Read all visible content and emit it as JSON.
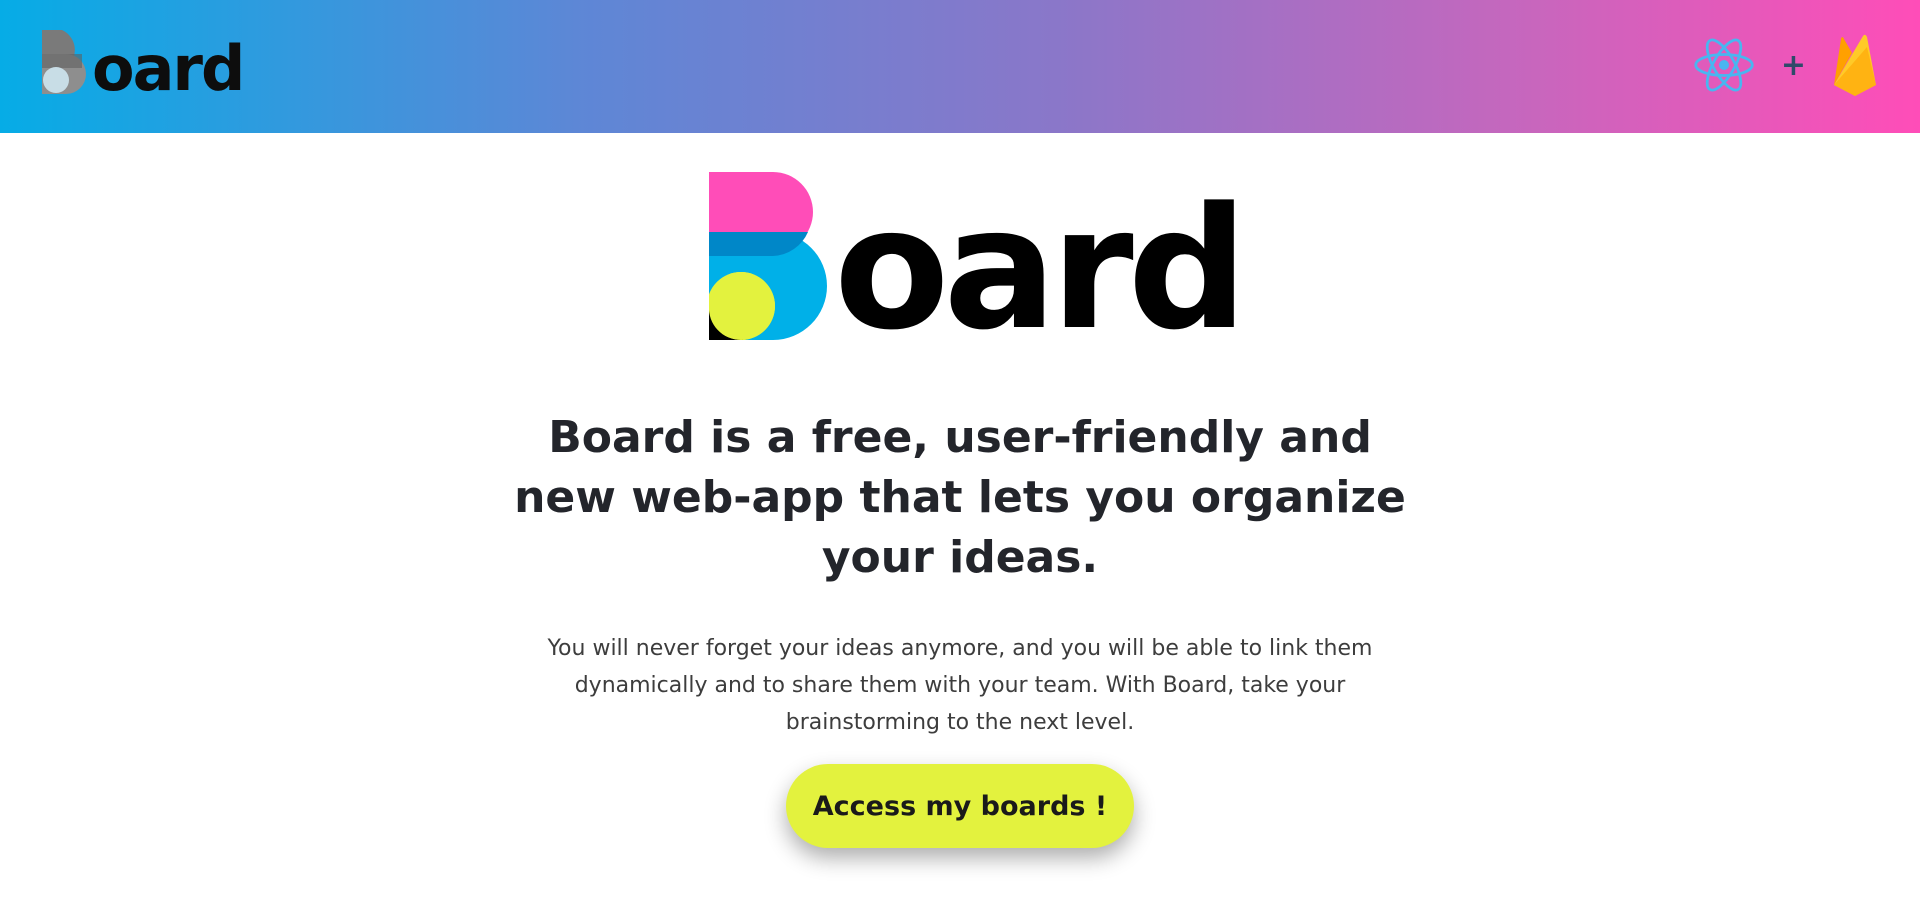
{
  "header": {
    "logo": {
      "icon": "board-b-logo-icon",
      "wordmark": "oard"
    },
    "tech_stack": {
      "items": [
        "react-icon",
        "firebase-icon"
      ],
      "separator": "+"
    }
  },
  "hero": {
    "logo": {
      "icon": "board-b-logo-icon",
      "wordmark": "oard"
    },
    "headline": "Board is a free, user-friendly and new web-app that lets you organize your ideas.",
    "description": "You will never forget your ideas anymore, and you will be able to link them dynamically and to share them with your team. With Board, take your brainstorming to the next level.",
    "cta_label": "Access my boards !"
  },
  "colors": {
    "brand_pink": "#ff4db8",
    "brand_blue": "#00b0e8",
    "brand_dark_blue": "#0087c8",
    "brand_yellow": "#e3f23e",
    "header_gradient_start": "#06ace6",
    "header_gradient_end": "#ff4db8",
    "cta_background": "#e3f23e",
    "text_dark": "#23252b"
  }
}
